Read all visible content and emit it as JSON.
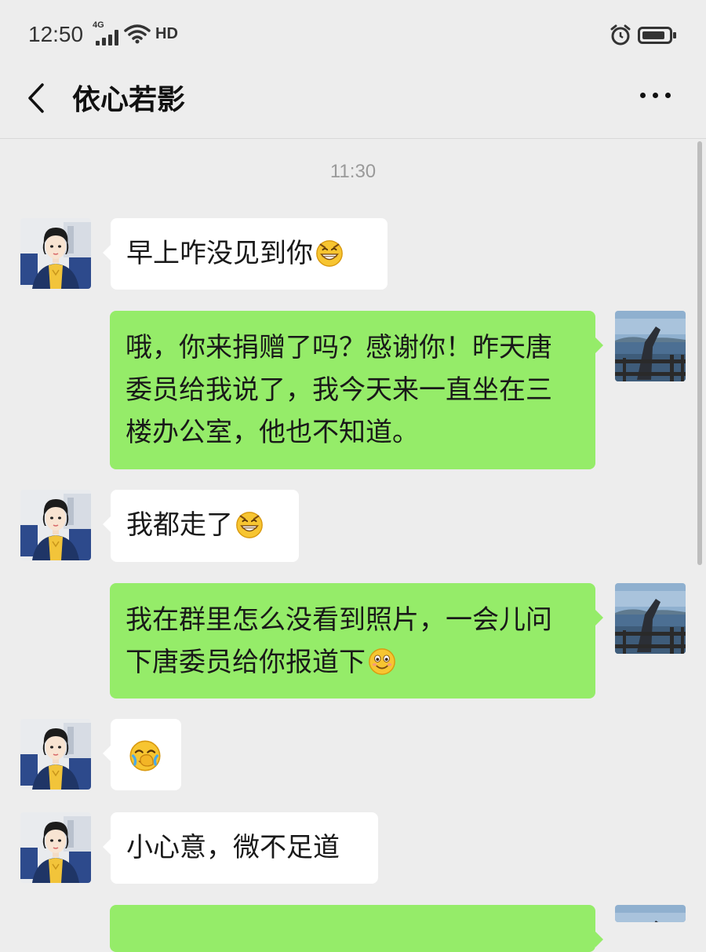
{
  "status_bar": {
    "time": "12:50",
    "network": "4G",
    "hd": "HD",
    "icons": [
      "signal-icon",
      "wifi-icon",
      "alarm-icon",
      "battery-icon"
    ]
  },
  "nav": {
    "title": "依心若影",
    "back_icon": "chevron-left-icon",
    "more_icon": "more-icon"
  },
  "chat": {
    "timestamp": "11:30",
    "messages": [
      {
        "side": "left",
        "text": "早上咋没见到你",
        "emoji": "grin"
      },
      {
        "side": "right",
        "lines": [
          "哦，你来捐赠了吗？感谢你！昨天唐",
          "委员给我说了，我今天来一直坐在三",
          "楼办公室，他也不知道。"
        ]
      },
      {
        "side": "left",
        "text": "我都走了",
        "emoji": "grin"
      },
      {
        "side": "right",
        "lines": [
          "我在群里怎么没看到照片，一会儿问",
          "下唐委员给你报道下"
        ],
        "emoji": "smile"
      },
      {
        "side": "left",
        "emoji": "facepalm"
      },
      {
        "side": "left",
        "text": "小心意，微不足道"
      },
      {
        "side": "right",
        "text": ""
      }
    ]
  },
  "colors": {
    "background": "#ededed",
    "bubble_self": "#95ec69",
    "bubble_other": "#ffffff"
  }
}
